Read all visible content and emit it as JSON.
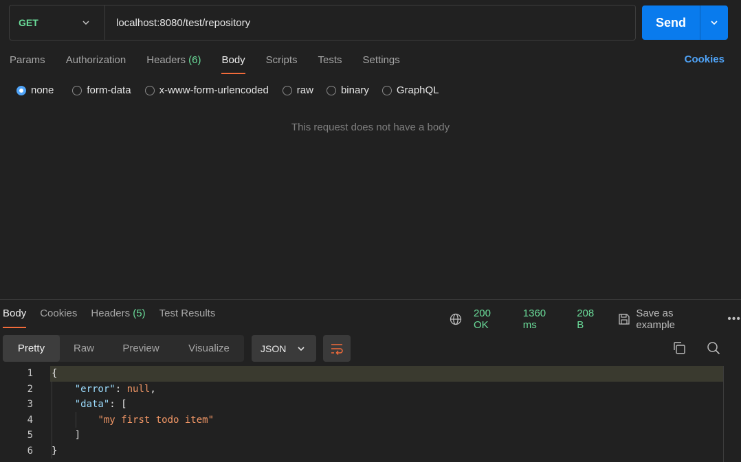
{
  "request": {
    "method": "GET",
    "url": "localhost:8080/test/repository",
    "send_label": "Send"
  },
  "req_tabs": {
    "params": "Params",
    "authorization": "Authorization",
    "headers": "Headers",
    "headers_count": "(6)",
    "body": "Body",
    "scripts": "Scripts",
    "tests": "Tests",
    "settings": "Settings",
    "cookies": "Cookies"
  },
  "body_types": {
    "none": "none",
    "form_data": "form-data",
    "urlencoded": "x-www-form-urlencoded",
    "raw": "raw",
    "binary": "binary",
    "graphql": "GraphQL",
    "selected": "none"
  },
  "empty_body_text": "This request does not have a body",
  "response": {
    "tabs": {
      "body": "Body",
      "cookies": "Cookies",
      "headers": "Headers",
      "headers_count": "(5)",
      "test_results": "Test Results"
    },
    "status": "200 OK",
    "time": "1360 ms",
    "size": "208 B",
    "save_example": "Save as example",
    "view_tabs": {
      "pretty": "Pretty",
      "raw": "Raw",
      "preview": "Preview",
      "visualize": "Visualize"
    },
    "format": "JSON",
    "lines": [
      {
        "num": "1"
      },
      {
        "num": "2"
      },
      {
        "num": "3"
      },
      {
        "num": "4"
      },
      {
        "num": "5"
      },
      {
        "num": "6"
      }
    ],
    "code": {
      "open_brace": "{",
      "error_key": "\"error\"",
      "error_val": "null",
      "data_key": "\"data\"",
      "open_bracket": "[",
      "item": "\"my first todo item\"",
      "close_bracket": "]",
      "close_brace": "}"
    }
  },
  "colors": {
    "accent_blue": "#097bed",
    "active_tab_underline": "#f26b3a",
    "success_green": "#6bdd9a"
  },
  "icons": [
    "chevron-down-icon",
    "globe-icon",
    "save-icon",
    "more-icon",
    "wrap-icon",
    "copy-icon",
    "search-icon"
  ]
}
